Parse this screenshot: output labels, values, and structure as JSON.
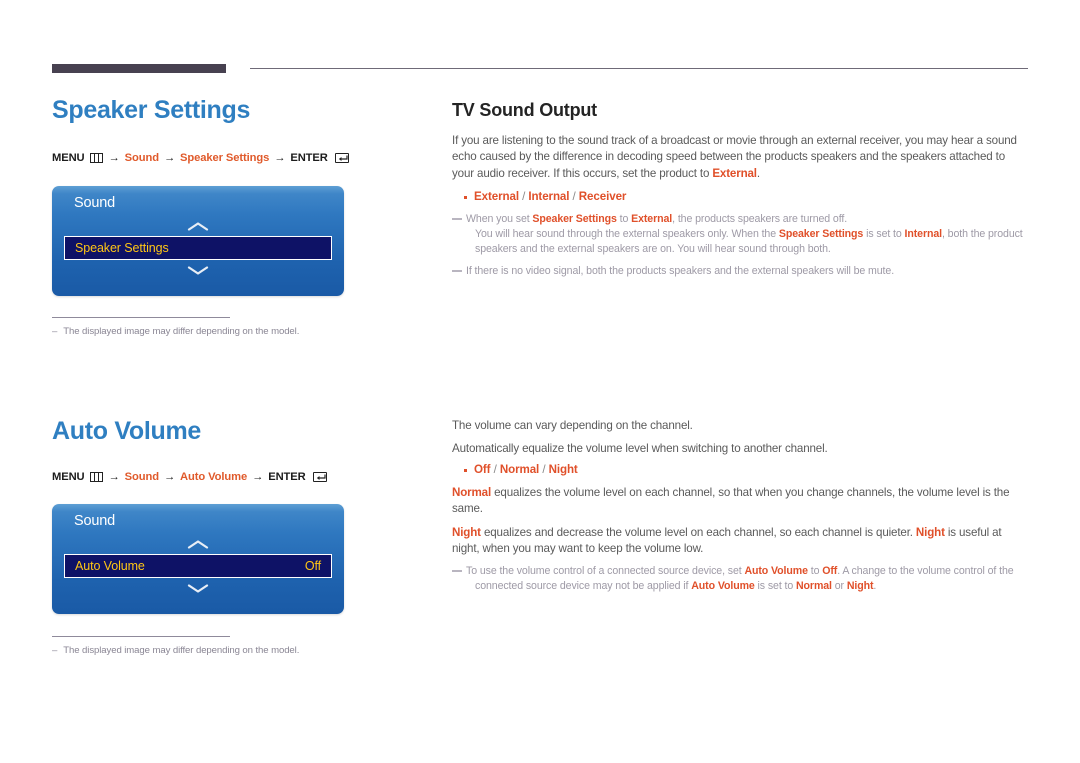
{
  "page": {
    "header_rule": {
      "present": true
    }
  },
  "sections": [
    {
      "id": "speaker-settings",
      "title": "Speaker Settings",
      "menu_path": {
        "menu_label": "MENU",
        "menu_icon": "menu-bars-icon",
        "arrow": "→",
        "step1": "Sound",
        "step2": "Speaker Settings",
        "enter_label": "ENTER",
        "enter_icon": "enter-return-icon"
      },
      "panel": {
        "title": "Sound",
        "up_icon": "chevron-up-icon",
        "down_icon": "chevron-down-icon",
        "row_label": "Speaker Settings",
        "row_value": ""
      },
      "footnote": {
        "dash": "–",
        "text": "The displayed image may differ depending on the model."
      },
      "topic": {
        "title": "TV Sound Output",
        "intro_p1_a": "If you are listening to the sound track of a broadcast or movie through an external receiver, you may hear a sound echo caused by the difference in decoding speed between the products speakers and the speakers attached to your audio receiver. If this occurs, set the product to ",
        "intro_p1_b": "External",
        "intro_p1_c": ".",
        "options": [
          "External",
          "Internal",
          "Receiver"
        ],
        "option_separator": "/",
        "notes": [
          {
            "lines": [
              {
                "indent": false,
                "parts": [
                  {
                    "t": "When you set ",
                    "bold": false
                  },
                  {
                    "t": "Speaker Settings",
                    "bold": true
                  },
                  {
                    "t": " to ",
                    "bold": false
                  },
                  {
                    "t": "External",
                    "bold": true
                  },
                  {
                    "t": ", the products speakers are turned off.",
                    "bold": false
                  }
                ]
              },
              {
                "indent": true,
                "parts": [
                  {
                    "t": "You will hear sound through the external speakers only. When the ",
                    "bold": false
                  },
                  {
                    "t": "Speaker Settings",
                    "bold": true
                  },
                  {
                    "t": " is set to ",
                    "bold": false
                  },
                  {
                    "t": "Internal",
                    "bold": true
                  },
                  {
                    "t": ", both the product speakers and the external speakers are on. You will hear sound through both.",
                    "bold": false
                  }
                ]
              }
            ]
          },
          {
            "lines": [
              {
                "indent": false,
                "parts": [
                  {
                    "t": "If there is no video signal, both the products speakers and the external speakers will be mute.",
                    "bold": false
                  }
                ]
              }
            ]
          }
        ]
      }
    },
    {
      "id": "auto-volume",
      "title": "Auto Volume",
      "menu_path": {
        "menu_label": "MENU",
        "menu_icon": "menu-bars-icon",
        "arrow": "→",
        "step1": "Sound",
        "step2": "Auto Volume",
        "enter_label": "ENTER",
        "enter_icon": "enter-return-icon"
      },
      "panel": {
        "title": "Sound",
        "up_icon": "chevron-up-icon",
        "down_icon": "chevron-down-icon",
        "row_label": "Auto Volume",
        "row_value": "Off"
      },
      "footnote": {
        "dash": "–",
        "text": "The displayed image may differ depending on the model."
      },
      "topic": {
        "title": "",
        "p1": "The volume can vary depending on the channel.",
        "p2": "Automatically equalize the volume level when switching to another channel.",
        "options": [
          "Off",
          "Normal",
          "Night"
        ],
        "option_separator": "/",
        "p3_a": "Normal",
        "p3_b": " equalizes the volume level on each channel, so that when you change channels, the volume level is the same.",
        "p4_a": "Night",
        "p4_b": " equalizes and decrease the volume level on each channel, so each channel is quieter. ",
        "p4_c": "Night",
        "p4_d": " is useful at night, when you may want to keep the volume low.",
        "notes": [
          {
            "lines": [
              {
                "indent": false,
                "parts": [
                  {
                    "t": "To use the volume control of a connected source device, set ",
                    "bold": false
                  },
                  {
                    "t": "Auto Volume",
                    "bold": true
                  },
                  {
                    "t": " to ",
                    "bold": false
                  },
                  {
                    "t": "Off",
                    "bold": true
                  },
                  {
                    "t": ". A change to the volume control of the",
                    "bold": false
                  }
                ]
              },
              {
                "indent": true,
                "parts": [
                  {
                    "t": "connected source device may not be applied if ",
                    "bold": false
                  },
                  {
                    "t": "Auto Volume",
                    "bold": true
                  },
                  {
                    "t": " is set to ",
                    "bold": false
                  },
                  {
                    "t": "Normal",
                    "bold": true
                  },
                  {
                    "t": " or ",
                    "bold": false
                  },
                  {
                    "t": "Night",
                    "bold": true
                  },
                  {
                    "t": ".",
                    "bold": false
                  }
                ]
              }
            ]
          }
        ]
      }
    }
  ],
  "colors": {
    "heading_blue": "#2f7fc1",
    "accent_orange": "#e0502a",
    "panel_blue_top": "#5e9fd4",
    "panel_blue_bottom": "#1a5aa6",
    "row_navy": "#0e1266",
    "row_yellow": "#ffc615",
    "rule_dark": "#474150",
    "footnote_gray": "#8a8694"
  }
}
